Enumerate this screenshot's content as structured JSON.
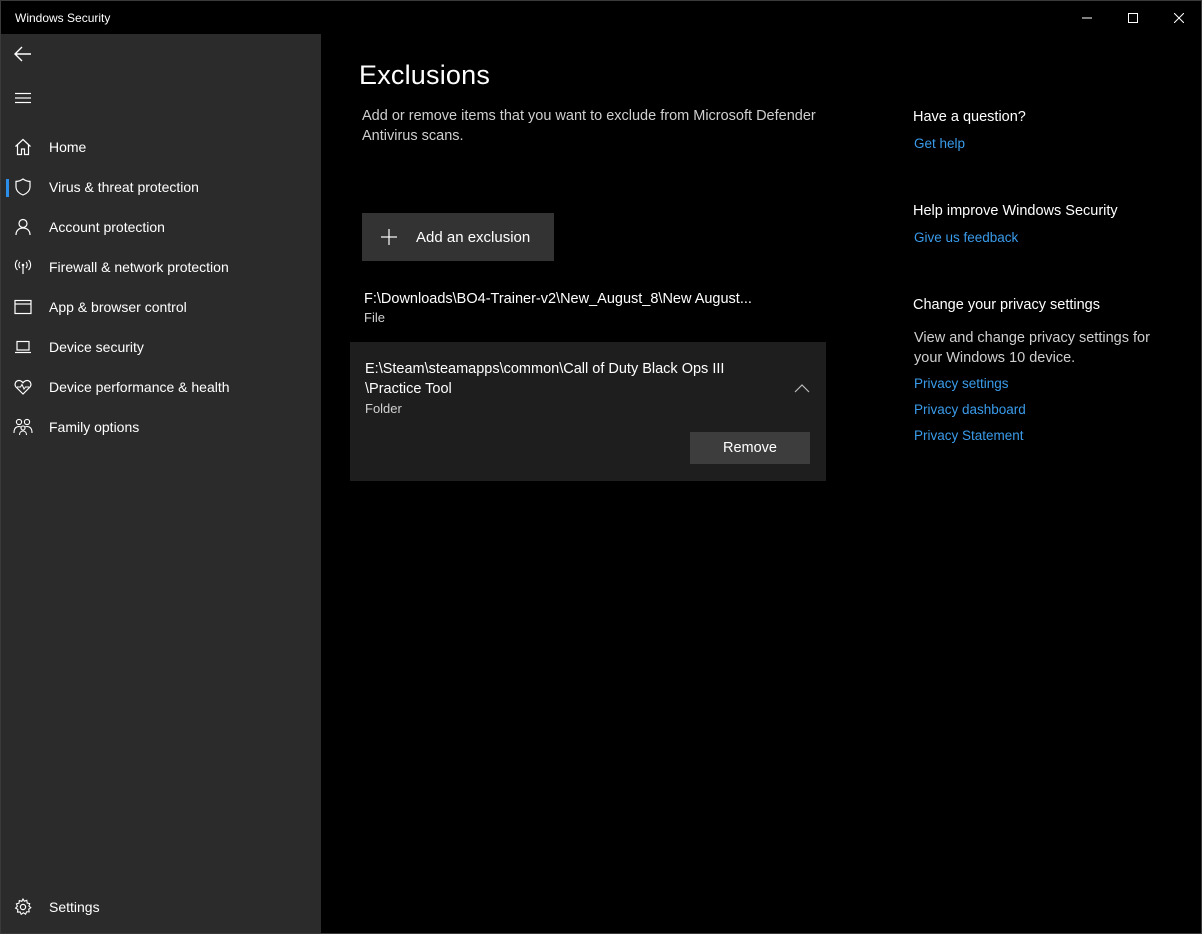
{
  "window": {
    "title": "Windows Security"
  },
  "sidebar": {
    "items": [
      {
        "label": "Home",
        "icon": "home-icon"
      },
      {
        "label": "Virus & threat protection",
        "icon": "shield-icon",
        "selected": true
      },
      {
        "label": "Account protection",
        "icon": "person-icon"
      },
      {
        "label": "Firewall & network protection",
        "icon": "wifi-antenna-icon"
      },
      {
        "label": "App & browser control",
        "icon": "browser-window-icon"
      },
      {
        "label": "Device security",
        "icon": "laptop-icon"
      },
      {
        "label": "Device performance & health",
        "icon": "heart-pulse-icon"
      },
      {
        "label": "Family options",
        "icon": "family-icon"
      }
    ],
    "settings_label": "Settings"
  },
  "main": {
    "title": "Exclusions",
    "description": "Add or remove items that you want to exclude from Microsoft Defender Antivirus scans.",
    "add_button_label": "Add an exclusion",
    "exclusions": [
      {
        "path": "F:\\Downloads\\BO4-Trainer-v2\\New_August_8\\New August...",
        "type": "File"
      },
      {
        "path": "E:\\Steam\\steamapps\\common\\Call of Duty Black Ops III\\Practice Tool",
        "path_line1": "E:\\Steam\\steamapps\\common\\Call of Duty Black Ops III",
        "path_line2": "\\Practice Tool",
        "type": "Folder",
        "remove_label": "Remove",
        "expanded": true
      }
    ]
  },
  "side": {
    "question_heading": "Have a question?",
    "get_help": "Get help",
    "improve_heading": "Help improve Windows Security",
    "feedback": "Give us feedback",
    "privacy_heading": "Change your privacy settings",
    "privacy_text": "View and change privacy settings for your Windows 10 device.",
    "privacy_links": [
      "Privacy settings",
      "Privacy dashboard",
      "Privacy Statement"
    ]
  },
  "colors": {
    "accent": "#2b8ee8",
    "link": "#3a9bea",
    "sidebar_bg": "#2b2b2b",
    "main_bg": "#000000"
  }
}
